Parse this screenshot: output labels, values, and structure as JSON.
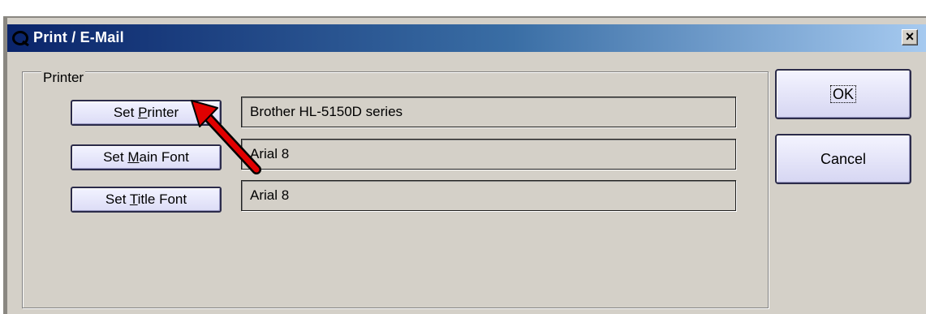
{
  "window": {
    "title": "Print / E-Mail",
    "close_label": "×"
  },
  "printer_group": {
    "legend": "Printer",
    "rows": [
      {
        "button": "Set Printer",
        "mnemonic_index": 4,
        "value": "Brother HL-5150D series"
      },
      {
        "button": "Set Main Font",
        "mnemonic_index": 4,
        "value": "Arial 8"
      },
      {
        "button": "Set Title Font",
        "mnemonic_index": 4,
        "value": "Arial 8"
      }
    ]
  },
  "actions": {
    "ok_label": "OK",
    "cancel_label": "Cancel"
  },
  "colors": {
    "title_gradient_start": "#0a246a",
    "title_gradient_end": "#a6caf0",
    "annotation_arrow": "#e00000"
  },
  "icons": {
    "app": "app-logo-icon",
    "close": "close-icon",
    "annotation": "red-arrow-annotation-icon"
  }
}
